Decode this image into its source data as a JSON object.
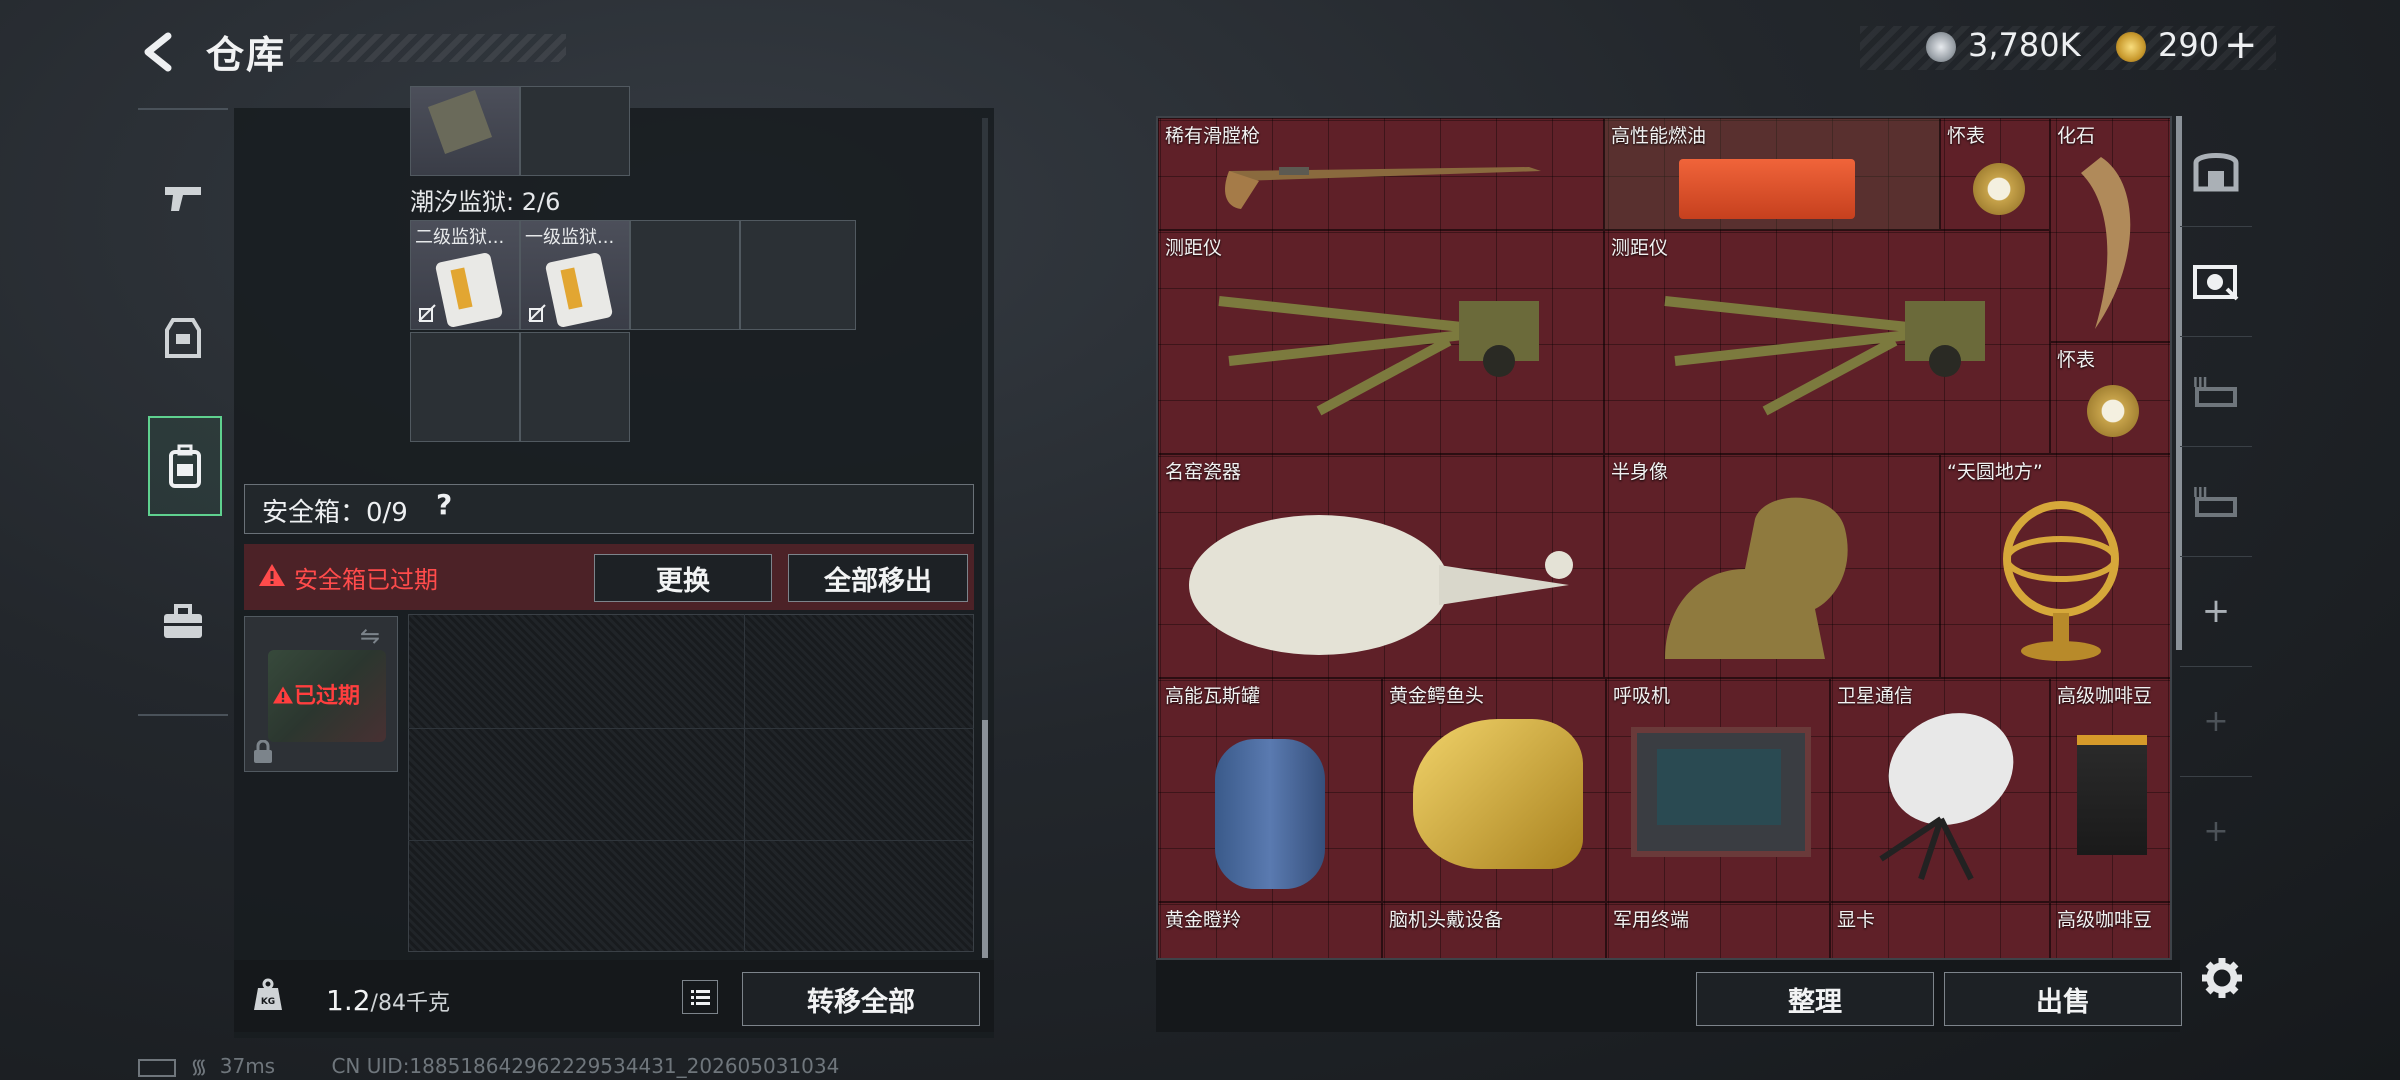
{
  "header": {
    "title": "仓库",
    "currency_silver": "3,780K",
    "currency_gold": "290",
    "add_label": "+"
  },
  "colors": {
    "accent_green": "#5fd18f",
    "loot_bg": "#5f2028",
    "warning_red": "#ff4b4b"
  },
  "left_nav": {
    "icons": [
      "gun-icon",
      "armor-vest-icon",
      "backpack-icon",
      "toolbox-icon"
    ],
    "active": "backpack-icon"
  },
  "inventory": {
    "section_label": "潮汐监狱: 2/6",
    "keycards": [
      "二级监狱...",
      "一级监狱..."
    ]
  },
  "safebox": {
    "label": "安全箱：0/9",
    "help": "?",
    "expired_text": "安全箱已过期",
    "replace_label": "更换",
    "remove_all_label": "全部移出",
    "case_status": "已过期"
  },
  "bottom": {
    "weight_current": "1.2",
    "weight_max": "/84千克",
    "transfer_all_label": "转移全部",
    "sort_label": "整理",
    "sell_label": "出售"
  },
  "status_bar": {
    "ping": "37ms",
    "uid": "CN UID:188518642962229534431_202605031034"
  },
  "loot": [
    {
      "name": "稀有滑膛枪"
    },
    {
      "name": "高性能燃油"
    },
    {
      "name": "怀表"
    },
    {
      "name": "化石"
    },
    {
      "name": "测距仪"
    },
    {
      "name": "测距仪"
    },
    {
      "name": "怀表"
    },
    {
      "name": "名窑瓷器"
    },
    {
      "name": "半身像"
    },
    {
      "name": "“天圆地方”"
    },
    {
      "name": "高能瓦斯罐"
    },
    {
      "name": "黄金鳄鱼头"
    },
    {
      "name": "呼吸机"
    },
    {
      "name": "卫星通信"
    },
    {
      "name": "高级咖啡豆"
    },
    {
      "name": "黄金瞪羚"
    },
    {
      "name": "脑机头戴设备"
    },
    {
      "name": "军用终端"
    },
    {
      "name": "显卡"
    },
    {
      "name": "高级咖啡豆"
    }
  ]
}
